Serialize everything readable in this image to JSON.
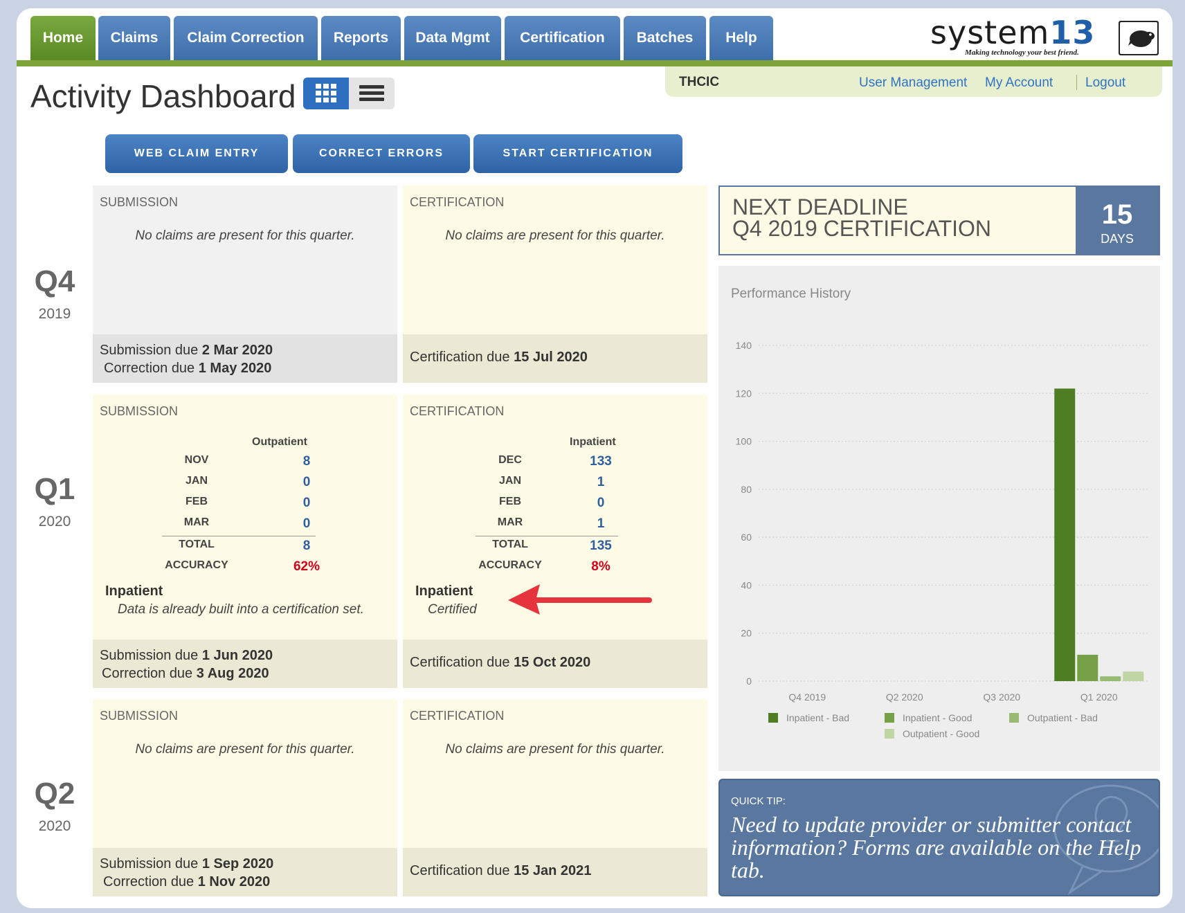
{
  "nav": {
    "tabs": [
      "Home",
      "Claims",
      "Claim Correction",
      "Reports",
      "Data Mgmt",
      "Certification",
      "Batches",
      "Help"
    ],
    "active": "Home"
  },
  "logo": {
    "word": "system",
    "number": "13",
    "tagline": "Making technology your best friend."
  },
  "subbar": {
    "org": "THCIC",
    "links": [
      "User Management",
      "My Account",
      "Logout"
    ]
  },
  "page": {
    "title": "Activity Dashboard"
  },
  "actions": [
    "WEB CLAIM ENTRY",
    "CORRECT ERRORS",
    "START CERTIFICATION"
  ],
  "quarters": [
    {
      "name": "Q4",
      "year": "2019",
      "submission": {
        "head": "SUBMISSION",
        "empty": "No claims are present for this quarter.",
        "due1_label": "Submission due",
        "due1_date": "2 Mar 2020",
        "due2_label": "Correction due",
        "due2_date": "1 May 2020"
      },
      "certification": {
        "head": "CERTIFICATION",
        "empty": "No claims are present for this quarter.",
        "due_label": "Certification due",
        "due_date": "15 Jul 2020"
      }
    },
    {
      "name": "Q1",
      "year": "2020",
      "submission": {
        "head": "SUBMISSION",
        "col": "Outpatient",
        "rows": [
          [
            "NOV",
            "8"
          ],
          [
            "JAN",
            "0"
          ],
          [
            "FEB",
            "0"
          ],
          [
            "MAR",
            "0"
          ]
        ],
        "total_label": "TOTAL",
        "total": "8",
        "accuracy_label": "ACCURACY",
        "accuracy": "62%",
        "note_title": "Inpatient",
        "note_body": "Data is already built into a certification set.",
        "due1_label": "Submission due",
        "due1_date": "1 Jun 2020",
        "due2_label": "Correction due",
        "due2_date": "3 Aug 2020"
      },
      "certification": {
        "head": "CERTIFICATION",
        "col": "Inpatient",
        "rows": [
          [
            "DEC",
            "133"
          ],
          [
            "JAN",
            "1"
          ],
          [
            "FEB",
            "0"
          ],
          [
            "MAR",
            "1"
          ]
        ],
        "total_label": "TOTAL",
        "total": "135",
        "accuracy_label": "ACCURACY",
        "accuracy": "8%",
        "note_title": "Inpatient",
        "note_body": "Certified",
        "due_label": "Certification due",
        "due_date": "15 Oct 2020"
      }
    },
    {
      "name": "Q2",
      "year": "2020",
      "submission": {
        "head": "SUBMISSION",
        "empty": "No claims are present for this quarter.",
        "due1_label": "Submission due",
        "due1_date": "1 Sep 2020",
        "due2_label": "Correction due",
        "due2_date": "1 Nov 2020"
      },
      "certification": {
        "head": "CERTIFICATION",
        "empty": "No claims are present for this quarter.",
        "due_label": "Certification due",
        "due_date": "15 Jan 2021"
      }
    }
  ],
  "deadline": {
    "line1": "NEXT DEADLINE",
    "line2": "Q4 2019 CERTIFICATION",
    "days": "15",
    "unit": "DAYS"
  },
  "chart_data": {
    "type": "bar",
    "title": "Performance History",
    "categories": [
      "Q4 2019",
      "Q2 2020",
      "Q3 2020",
      "Q1 2020"
    ],
    "ylim": [
      0,
      140
    ],
    "yticks": [
      0,
      20,
      40,
      60,
      80,
      100,
      120,
      140
    ],
    "grid": true,
    "legend_position": "bottom",
    "series": [
      {
        "name": "Inpatient - Bad",
        "color": "#4e7d23",
        "values": [
          0,
          0,
          0,
          122
        ]
      },
      {
        "name": "Inpatient - Good",
        "color": "#76a046",
        "values": [
          0,
          0,
          0,
          11
        ]
      },
      {
        "name": "Outpatient - Bad",
        "color": "#98ba72",
        "values": [
          0,
          0,
          0,
          2
        ]
      },
      {
        "name": "Outpatient - Good",
        "color": "#bfd6a4",
        "values": [
          0,
          0,
          0,
          4
        ]
      }
    ]
  },
  "tip": {
    "label": "QUICK TIP:",
    "text": "Need to update provider or submitter contact information? Forms are available on the Help tab."
  },
  "colors": {
    "nav_blue": "#4a7ab5",
    "nav_active": "#6d9a33",
    "accent_red": "#d0021b",
    "card_cream": "#fdfae6"
  }
}
